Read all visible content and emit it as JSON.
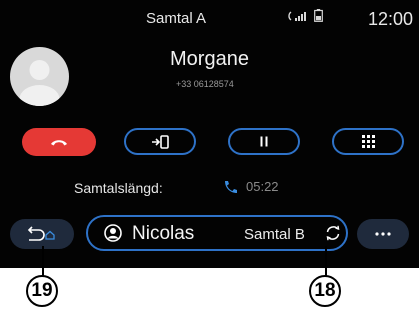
{
  "header": {
    "title": "Samtal A",
    "time": "12:00"
  },
  "contact": {
    "name": "Morgane",
    "number": "+33 06128574"
  },
  "call_controls": [
    {
      "id": "hang-up",
      "icon": "end-call-icon"
    },
    {
      "id": "transfer",
      "icon": "transfer-to-phone-icon"
    },
    {
      "id": "pause",
      "icon": "pause-icon"
    },
    {
      "id": "keypad",
      "icon": "keypad-icon"
    }
  ],
  "duration": {
    "label": "Samtalslängd:",
    "value": "05:22"
  },
  "bottom_bar": {
    "second_call_name": "Nicolas",
    "second_call_label": "Samtal B"
  },
  "callouts": {
    "back": "19",
    "swap": "18"
  },
  "colors": {
    "accent": "#2e72c8",
    "end_call": "#e53935",
    "background": "#030303"
  }
}
